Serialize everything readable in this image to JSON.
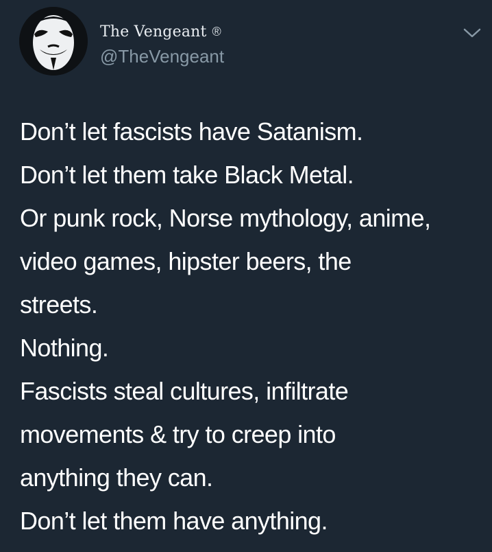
{
  "tweet": {
    "author": {
      "display_name": "The Vengeant",
      "badge_symbol": "®",
      "handle": "@TheVengeant"
    },
    "lines": [
      "Don’t let fascists have Satanism.",
      "Don’t let them take Black Metal.",
      "Or punk rock, Norse mythology, anime,",
      "video games, hipster beers, the",
      "streets.",
      "Nothing.",
      "Fascists steal cultures, infiltrate",
      "movements & try to creep into",
      "anything they can.",
      "Don’t let them have anything."
    ]
  },
  "colors": {
    "background": "#1c2733",
    "text": "#ffffff",
    "secondary_text": "#8899a6"
  },
  "icons": {
    "avatar": "guy-fawkes-mask-avatar",
    "badge": "registered-trademark-icon",
    "menu": "chevron-down-icon"
  }
}
